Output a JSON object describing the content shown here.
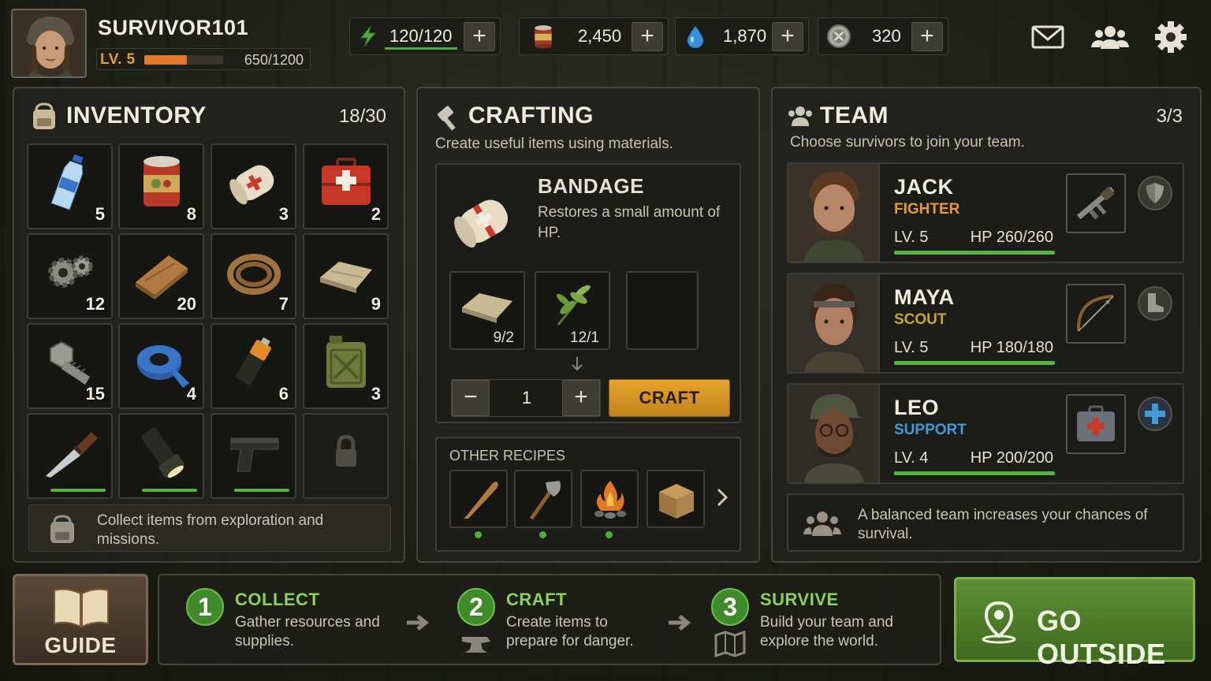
{
  "player": {
    "name": "SURVIVOR101",
    "level_label": "LV. 5",
    "xp_text": "650/1200",
    "xp_fraction": 0.54
  },
  "resources": {
    "energy": {
      "value": "120/120",
      "icon": "lightning-icon",
      "color": "#4caf3a"
    },
    "food": {
      "value": "2,450",
      "icon": "food-can-icon"
    },
    "water": {
      "value": "1,870",
      "icon": "water-drop-icon"
    },
    "parts": {
      "value": "320",
      "icon": "gear-coin-icon"
    },
    "plus_label": "+"
  },
  "top_icons": [
    "mail-icon",
    "friends-icon",
    "settings-icon"
  ],
  "inventory": {
    "title": "INVENTORY",
    "count": "18/30",
    "slots": [
      {
        "item": "water-bottle",
        "qty": "5"
      },
      {
        "item": "food-can",
        "qty": "8"
      },
      {
        "item": "bandage",
        "qty": "3"
      },
      {
        "item": "medkit",
        "qty": "2"
      },
      {
        "item": "scrap-metal",
        "qty": "12"
      },
      {
        "item": "wood-plank",
        "qty": "20"
      },
      {
        "item": "rope",
        "qty": "7"
      },
      {
        "item": "cloth",
        "qty": "9"
      },
      {
        "item": "bolt",
        "qty": "15"
      },
      {
        "item": "duct-tape",
        "qty": "4"
      },
      {
        "item": "battery",
        "qty": "6"
      },
      {
        "item": "fuel-canister",
        "qty": "3"
      },
      {
        "item": "knife",
        "qty": ""
      },
      {
        "item": "flashlight",
        "qty": ""
      },
      {
        "item": "pistol",
        "qty": ""
      },
      {
        "item": "locked",
        "qty": ""
      }
    ],
    "hint": "Collect items from exploration and missions."
  },
  "crafting": {
    "title": "CRAFTING",
    "subtitle": "Create useful items using materials.",
    "recipe": {
      "name": "BANDAGE",
      "desc": "Restores a small amount of HP."
    },
    "materials": [
      {
        "item": "cloth",
        "qty": "9/2"
      },
      {
        "item": "herb",
        "qty": "12/1"
      }
    ],
    "quantity": "1",
    "minus": "−",
    "plus": "+",
    "craft_label": "CRAFT",
    "other_title": "OTHER RECIPES",
    "other_recipes": [
      "baseball-bat",
      "hatchet",
      "campfire",
      "supply-crate"
    ]
  },
  "team": {
    "title": "TEAM",
    "count": "3/3",
    "subtitle": "Choose survivors to join your team.",
    "members": [
      {
        "name": "JACK",
        "role": "FIGHTER",
        "role_color": "#e69a3a",
        "level": "LV. 5",
        "hp": "HP 260/260",
        "hp_fraction": 1.0,
        "equip": "assault-rifle-icon",
        "badge": "shield-icon"
      },
      {
        "name": "MAYA",
        "role": "SCOUT",
        "role_color": "#c7a82a",
        "level": "LV. 5",
        "hp": "HP 180/180",
        "hp_fraction": 1.0,
        "equip": "bow-icon",
        "badge": "boot-icon"
      },
      {
        "name": "LEO",
        "role": "SUPPORT",
        "role_color": "#3f9bd8",
        "level": "LV. 4",
        "hp": "HP 200/200",
        "hp_fraction": 1.0,
        "equip": "medkit-icon",
        "badge": "medical-cross-icon"
      }
    ],
    "hint": "A balanced team increases your chances of survival."
  },
  "guide": {
    "label": "GUIDE"
  },
  "steps": [
    {
      "num": "1",
      "title": "COLLECT",
      "desc": "Gather resources and supplies."
    },
    {
      "num": "2",
      "title": "CRAFT",
      "desc": "Create items to prepare for danger."
    },
    {
      "num": "3",
      "title": "SURVIVE",
      "desc": "Build your team and explore the world."
    }
  ],
  "go_outside": {
    "label": "GO OUTSIDE"
  }
}
